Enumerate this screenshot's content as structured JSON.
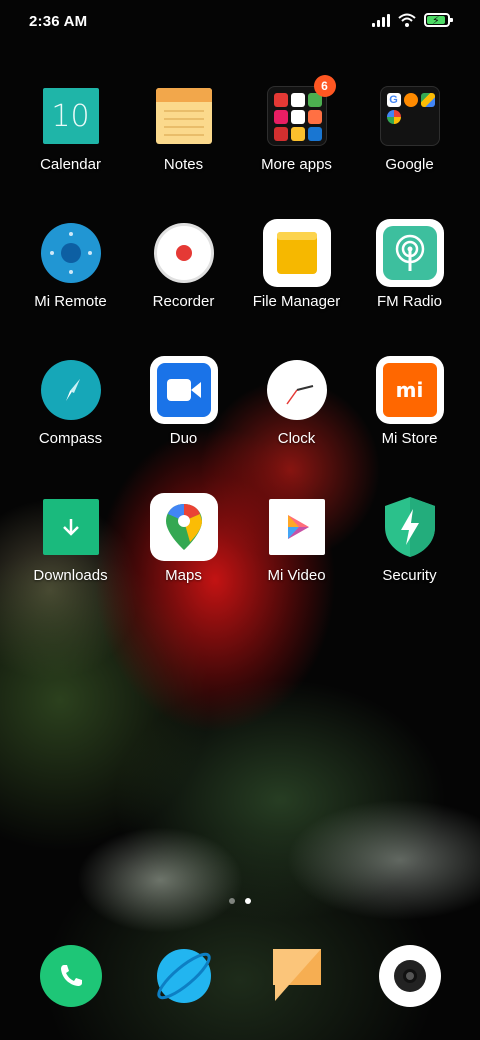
{
  "status_bar": {
    "time": "2:36 AM",
    "icons": [
      "signal-icon",
      "wifi-icon",
      "battery-charging-icon"
    ],
    "battery_fill": 0.8
  },
  "apps": [
    {
      "label": "Calendar",
      "icon": "calendar-icon",
      "date_text": "10"
    },
    {
      "label": "Notes",
      "icon": "notes-icon"
    },
    {
      "label": "More apps",
      "icon": "folder-icon",
      "badge": "6"
    },
    {
      "label": "Google",
      "icon": "folder-icon"
    },
    {
      "label": "Mi Remote",
      "icon": "remote-icon"
    },
    {
      "label": "Recorder",
      "icon": "record-icon"
    },
    {
      "label": "File Manager",
      "icon": "folder-file-icon"
    },
    {
      "label": "FM Radio",
      "icon": "radio-icon"
    },
    {
      "label": "Compass",
      "icon": "compass-icon"
    },
    {
      "label": "Duo",
      "icon": "video-camera-icon"
    },
    {
      "label": "Clock",
      "icon": "clock-icon"
    },
    {
      "label": "Mi Store",
      "icon": "mi-store-icon",
      "logo_text": "mi"
    },
    {
      "label": "Downloads",
      "icon": "download-icon"
    },
    {
      "label": "Maps",
      "icon": "map-pin-icon"
    },
    {
      "label": "Mi Video",
      "icon": "play-icon"
    },
    {
      "label": "Security",
      "icon": "shield-bolt-icon"
    }
  ],
  "page_indicator": {
    "pages": 2,
    "current": 2
  },
  "dock": [
    {
      "icon": "phone-icon"
    },
    {
      "icon": "browser-icon"
    },
    {
      "icon": "messages-icon"
    },
    {
      "icon": "camera-icon"
    }
  ],
  "colors": {
    "calendar": "#1fb5a8",
    "notes": "#fbd98c",
    "badge": "#ff5722",
    "remote": "#2196d3",
    "recorder": "#e53935",
    "file_manager": "#f6b800",
    "fm_radio": "#3dbf9e",
    "compass": "#16a7b8",
    "duo": "#1a73e8",
    "mi_store": "#ff6700",
    "downloads": "#1aba7d",
    "security": "#2bc18b",
    "phone": "#1ec677",
    "browser": "#22b5f0",
    "messages": "#fbc57a"
  }
}
